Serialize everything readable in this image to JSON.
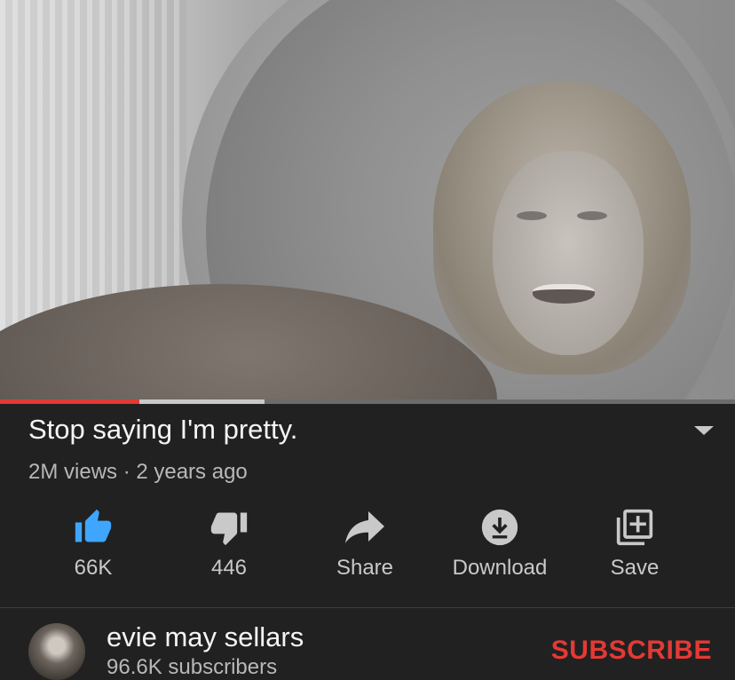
{
  "video": {
    "progress_played": 0.19,
    "progress_buffered": 0.36
  },
  "title": "Stop saying I'm pretty.",
  "meta": "2M views · 2 years ago",
  "actions": {
    "like": "66K",
    "dislike": "446",
    "share": "Share",
    "download": "Download",
    "save": "Save"
  },
  "channel": {
    "name": "evie may sellars",
    "subscribers": "96.6K subscribers",
    "subscribe": "SUBSCRIBE"
  },
  "colors": {
    "background": "#212121",
    "accent": "#e53935",
    "like_active": "#3ea6ff",
    "secondary_text": "#b8b8b8"
  },
  "icons": [
    "thumbs-up-icon",
    "thumbs-down-icon",
    "share-icon",
    "download-icon",
    "save-playlist-icon",
    "expand-icon"
  ]
}
